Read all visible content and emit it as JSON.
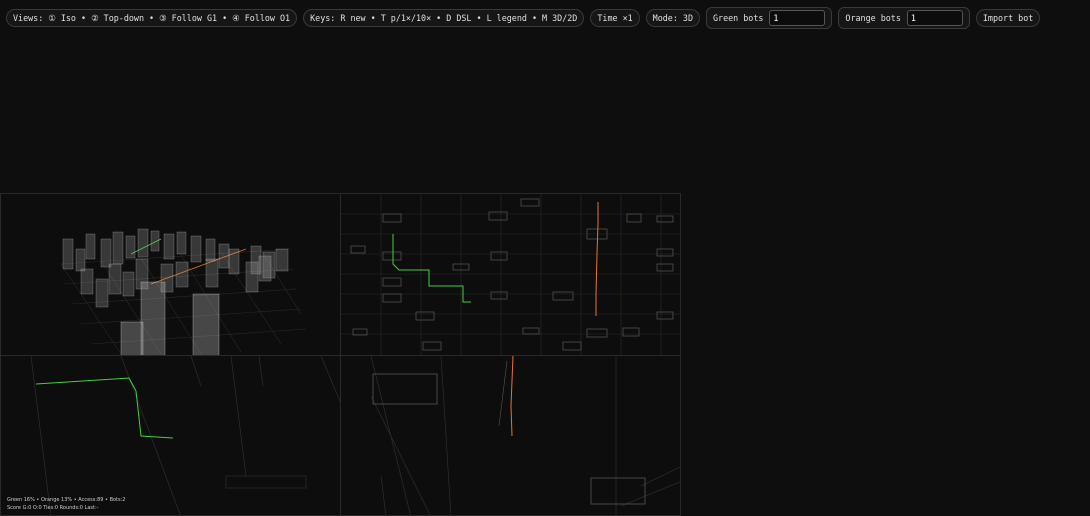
{
  "toolbar": {
    "views": "Views: ① Iso • ② Top-down • ③ Follow G1 • ④ Follow O1",
    "keys": "Keys: R new • T p/1×/10× • D DSL • L legend • M 3D/2D",
    "time": "Time ×1",
    "mode": "Mode: 3D",
    "green_label": "Green bots",
    "green_value": "1",
    "orange_label": "Orange bots",
    "orange_value": "1",
    "import_label": "Import bot"
  },
  "status": {
    "line1": "Green 16% • Orange 13% • Access:89 • Bots:2",
    "line2": "Score G:0 O:0  Ties:0  Rounds:0  Last:-"
  },
  "colors": {
    "background": "#0e0e0e",
    "green_trail": "#3fd23f",
    "orange_trail": "#e8742a",
    "grid": "#2c2c2c",
    "building": "#9a9a9a"
  }
}
